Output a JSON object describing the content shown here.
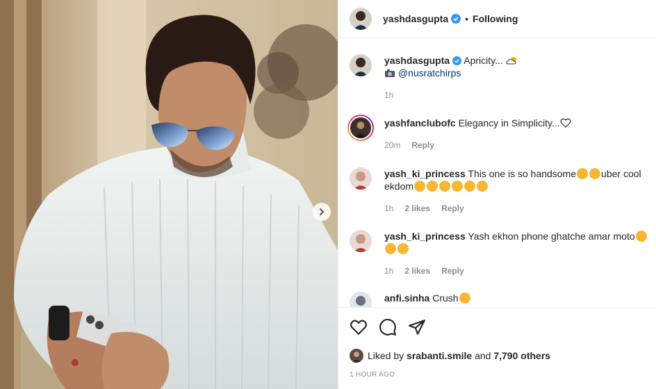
{
  "header": {
    "username": "yashdasgupta",
    "dot": "•",
    "follow_status": "Following"
  },
  "caption": {
    "username": "yashdasgupta",
    "text": "Apricity...",
    "mention": "@nusratchirps",
    "time": "1h"
  },
  "comments": [
    {
      "username": "yashfanclubofc",
      "text": "Elegancy in Simplicity...",
      "time": "20m",
      "likes": "",
      "reply": "Reply"
    },
    {
      "username": "yash_ki_princess",
      "text_a": "This one is so handsome",
      "text_b": "uber cool",
      "text_c": "ekdom",
      "time": "1h",
      "likes": "2 likes",
      "reply": "Reply"
    },
    {
      "username": "yash_ki_princess",
      "text": "Yash ekhon phone ghatche amar moto",
      "time": "1h",
      "likes": "2 likes",
      "reply": "Reply"
    },
    {
      "username": "anfi.sinha",
      "text": "Crush"
    }
  ],
  "likes": {
    "prefix": "Liked by",
    "user": "srabanti.smile",
    "and": "and",
    "others": "7,790 others"
  },
  "post_time": "1 HOUR AGO",
  "icons": {
    "verified": "verified-badge-icon",
    "like": "heart-icon",
    "comment": "comment-bubble-icon",
    "share": "paper-plane-icon",
    "next": "chevron-right-icon"
  },
  "colors": {
    "verified": "#3897f0",
    "link": "#00376b",
    "muted": "#8e8e8e",
    "emoji": "#f7b733",
    "heart_eye": "#e0245e"
  }
}
